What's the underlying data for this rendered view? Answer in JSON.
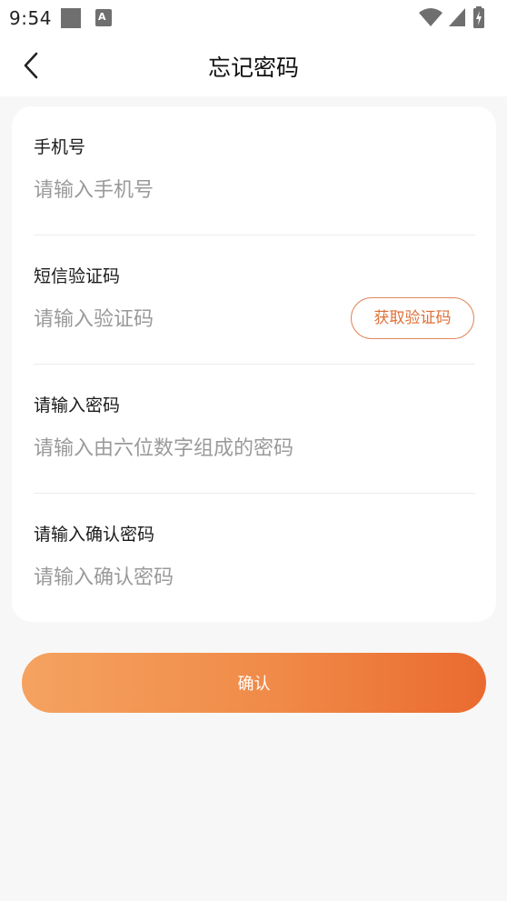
{
  "status_bar": {
    "time": "9:54",
    "notification_icon_letter": "A"
  },
  "nav": {
    "title": "忘记密码"
  },
  "form": {
    "phone": {
      "label": "手机号",
      "placeholder": "请输入手机号"
    },
    "sms_code": {
      "label": "短信验证码",
      "placeholder": "请输入验证码",
      "send_code_label": "获取验证码"
    },
    "password": {
      "label": "请输入密码",
      "placeholder": "请输入由六位数字组成的密码"
    },
    "confirm_password": {
      "label": "请输入确认密码",
      "placeholder": "请输入确认密码"
    }
  },
  "actions": {
    "confirm_label": "确认"
  },
  "colors": {
    "accent_start": "#f5a260",
    "accent_end": "#ea6a2f",
    "code_button_text": "#df6f37"
  },
  "icons": {
    "back": "chevron-left-icon",
    "wifi": "wifi-icon",
    "signal": "cell-signal-icon",
    "battery": "battery-charging-icon"
  }
}
